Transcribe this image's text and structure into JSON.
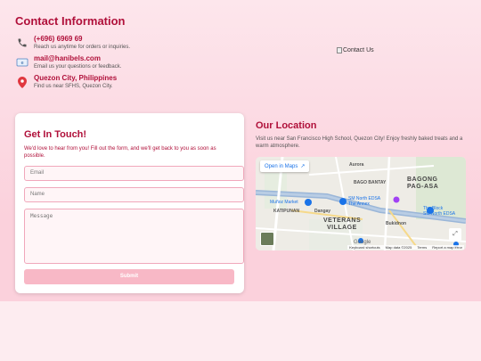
{
  "contact": {
    "title": "Contact Information",
    "items": [
      {
        "icon": "phone-icon",
        "main": "(+696) 6969 69",
        "sub": "Reach us anytime for orders or inquiries."
      },
      {
        "icon": "mail-icon",
        "main": "mail@hanibels.com",
        "sub": "Email us your questions or feedback."
      },
      {
        "icon": "pin-icon",
        "main": "Quezon City, Philippines",
        "sub": "Find us near SFHS, Quezon City."
      }
    ],
    "image_alt": "Contact Us"
  },
  "form": {
    "title": "Get In Touch!",
    "description": "We'd love to hear from you! Fill out the form, and we'll get back to you as soon as possible.",
    "email_placeholder": "Email",
    "name_placeholder": "Name",
    "message_placeholder": "Message",
    "submit_label": "Submit"
  },
  "location": {
    "title": "Our Location",
    "description": "Visit us near San Francisco High School, Quezon City! Enjoy freshly baked treats and a warm atmosphere.",
    "open_maps_label": "Open in Maps",
    "labels": {
      "aurora": "Aurora",
      "bagong_pag_asa_1": "BAGONG",
      "bagong_pag_asa_2": "PAG-ASA",
      "sm_north_1": "SM North EDSA",
      "sm_north_2": "The Annex",
      "the_block_1": "The Block",
      "the_block_2": "SM North EDSA",
      "veterans_1": "VETERANS",
      "veterans_2": "VILLAGE",
      "bago_bantay": "BAGO BANTAY",
      "katipunan": "KATIPUNAN",
      "munoz_market": "Muñoz Market",
      "bukidnon": "Bukidnon",
      "dangay": "Dangay"
    },
    "footer": {
      "shortcuts": "Keyboard shortcuts",
      "mapdata": "Map data ©2025",
      "terms": "Terms",
      "report": "Report a map error"
    },
    "google": "Google"
  },
  "colors": {
    "accent": "#b0103a",
    "bg_top": "#fde6ec",
    "bg_bottom": "#fbd1dc",
    "button": "#f8b8c6"
  }
}
